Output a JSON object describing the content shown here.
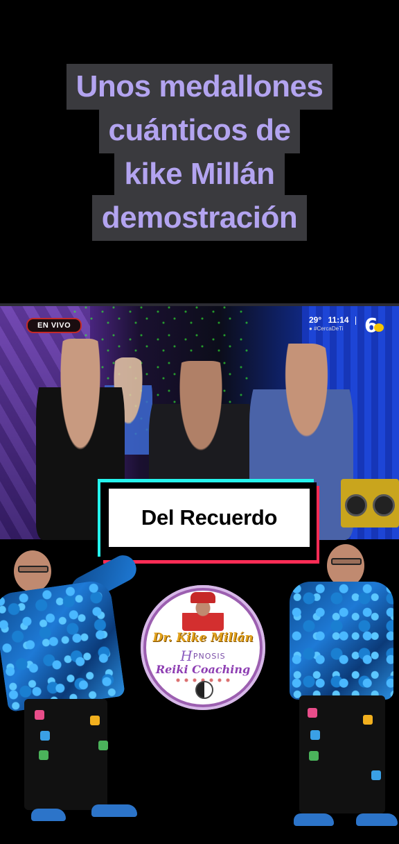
{
  "title": {
    "lines": [
      "Unos medallones",
      "cuánticos de",
      "kike Millán",
      "demostración"
    ]
  },
  "broadcast": {
    "live_badge": "EN VIVO",
    "temperature": "29°",
    "time": "11:14",
    "hashtag": "#CercaDeTi",
    "channel": "6"
  },
  "caption": {
    "text": "Del Recuerdo"
  },
  "logo": {
    "name": "Dr. Kike Millán",
    "hypnosis_initial": "H",
    "hypnosis_rest": "PNOSIS",
    "reiki": "Reiki Coaching"
  },
  "colors": {
    "title_text": "#b3a4f0",
    "title_bg": "#3a3a3e",
    "caption_cyan": "#25f4ee",
    "caption_red": "#fe2c55"
  }
}
